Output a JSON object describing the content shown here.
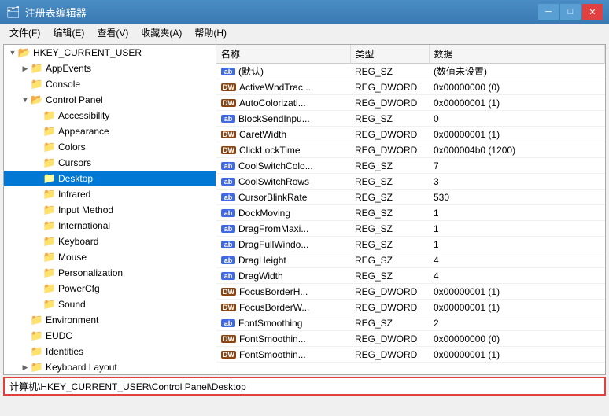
{
  "titleBar": {
    "title": "注册表编辑器",
    "icon": "🗂",
    "controls": {
      "minimize": "─",
      "maximize": "□",
      "close": "✕"
    }
  },
  "menuBar": {
    "items": [
      {
        "id": "file",
        "label": "文件(F)"
      },
      {
        "id": "edit",
        "label": "编辑(E)"
      },
      {
        "id": "view",
        "label": "查看(V)"
      },
      {
        "id": "favorites",
        "label": "收藏夹(A)"
      },
      {
        "id": "help",
        "label": "帮助(H)"
      }
    ]
  },
  "tree": {
    "items": [
      {
        "id": "hkcu",
        "label": "HKEY_CURRENT_USER",
        "indent": 0,
        "expanded": true,
        "selected": false,
        "hasExpand": true,
        "expandChar": "▼"
      },
      {
        "id": "appevents",
        "label": "AppEvents",
        "indent": 1,
        "expanded": false,
        "selected": false,
        "hasExpand": true,
        "expandChar": "▶"
      },
      {
        "id": "console",
        "label": "Console",
        "indent": 1,
        "expanded": false,
        "selected": false,
        "hasExpand": false,
        "expandChar": ""
      },
      {
        "id": "controlpanel",
        "label": "Control Panel",
        "indent": 1,
        "expanded": true,
        "selected": false,
        "hasExpand": true,
        "expandChar": "▼"
      },
      {
        "id": "accessibility",
        "label": "Accessibility",
        "indent": 2,
        "expanded": false,
        "selected": false,
        "hasExpand": false,
        "expandChar": ""
      },
      {
        "id": "appearance",
        "label": "Appearance",
        "indent": 2,
        "expanded": false,
        "selected": false,
        "hasExpand": false,
        "expandChar": ""
      },
      {
        "id": "colors",
        "label": "Colors",
        "indent": 2,
        "expanded": false,
        "selected": false,
        "hasExpand": false,
        "expandChar": ""
      },
      {
        "id": "cursors",
        "label": "Cursors",
        "indent": 2,
        "expanded": false,
        "selected": false,
        "hasExpand": false,
        "expandChar": ""
      },
      {
        "id": "desktop",
        "label": "Desktop",
        "indent": 2,
        "expanded": false,
        "selected": true,
        "hasExpand": false,
        "expandChar": ""
      },
      {
        "id": "infrared",
        "label": "Infrared",
        "indent": 2,
        "expanded": false,
        "selected": false,
        "hasExpand": false,
        "expandChar": ""
      },
      {
        "id": "inputmethod",
        "label": "Input Method",
        "indent": 2,
        "expanded": false,
        "selected": false,
        "hasExpand": false,
        "expandChar": ""
      },
      {
        "id": "international",
        "label": "International",
        "indent": 2,
        "expanded": false,
        "selected": false,
        "hasExpand": false,
        "expandChar": ""
      },
      {
        "id": "keyboard",
        "label": "Keyboard",
        "indent": 2,
        "expanded": false,
        "selected": false,
        "hasExpand": false,
        "expandChar": ""
      },
      {
        "id": "mouse",
        "label": "Mouse",
        "indent": 2,
        "expanded": false,
        "selected": false,
        "hasExpand": false,
        "expandChar": ""
      },
      {
        "id": "personalization",
        "label": "Personalization",
        "indent": 2,
        "expanded": false,
        "selected": false,
        "hasExpand": false,
        "expandChar": ""
      },
      {
        "id": "powercfg",
        "label": "PowerCfg",
        "indent": 2,
        "expanded": false,
        "selected": false,
        "hasExpand": false,
        "expandChar": ""
      },
      {
        "id": "sound",
        "label": "Sound",
        "indent": 2,
        "expanded": false,
        "selected": false,
        "hasExpand": false,
        "expandChar": ""
      },
      {
        "id": "environment",
        "label": "Environment",
        "indent": 1,
        "expanded": false,
        "selected": false,
        "hasExpand": false,
        "expandChar": ""
      },
      {
        "id": "eudc",
        "label": "EUDC",
        "indent": 1,
        "expanded": false,
        "selected": false,
        "hasExpand": false,
        "expandChar": ""
      },
      {
        "id": "identities",
        "label": "Identities",
        "indent": 1,
        "expanded": false,
        "selected": false,
        "hasExpand": false,
        "expandChar": ""
      },
      {
        "id": "keyboardlayout",
        "label": "Keyboard Layout",
        "indent": 1,
        "expanded": false,
        "selected": false,
        "hasExpand": true,
        "expandChar": "▶"
      }
    ]
  },
  "tableHeaders": {
    "name": "名称",
    "type": "类型",
    "data": "数据"
  },
  "tableRows": [
    {
      "iconType": "ab",
      "name": "(默认)",
      "type": "REG_SZ",
      "data": "(数值未设置)"
    },
    {
      "iconType": "dw",
      "name": "ActiveWndTrac...",
      "type": "REG_DWORD",
      "data": "0x00000000 (0)"
    },
    {
      "iconType": "dw",
      "name": "AutoColorizati...",
      "type": "REG_DWORD",
      "data": "0x00000001 (1)"
    },
    {
      "iconType": "ab",
      "name": "BlockSendInpu...",
      "type": "REG_SZ",
      "data": "0"
    },
    {
      "iconType": "dw",
      "name": "CaretWidth",
      "type": "REG_DWORD",
      "data": "0x00000001 (1)"
    },
    {
      "iconType": "dw",
      "name": "ClickLockTime",
      "type": "REG_DWORD",
      "data": "0x000004b0 (1200)"
    },
    {
      "iconType": "ab",
      "name": "CoolSwitchColo...",
      "type": "REG_SZ",
      "data": "7"
    },
    {
      "iconType": "ab",
      "name": "CoolSwitchRows",
      "type": "REG_SZ",
      "data": "3"
    },
    {
      "iconType": "ab",
      "name": "CursorBlinkRate",
      "type": "REG_SZ",
      "data": "530"
    },
    {
      "iconType": "ab",
      "name": "DockMoving",
      "type": "REG_SZ",
      "data": "1"
    },
    {
      "iconType": "ab",
      "name": "DragFromMaxi...",
      "type": "REG_SZ",
      "data": "1"
    },
    {
      "iconType": "ab",
      "name": "DragFullWindo...",
      "type": "REG_SZ",
      "data": "1"
    },
    {
      "iconType": "ab",
      "name": "DragHeight",
      "type": "REG_SZ",
      "data": "4"
    },
    {
      "iconType": "ab",
      "name": "DragWidth",
      "type": "REG_SZ",
      "data": "4"
    },
    {
      "iconType": "dw",
      "name": "FocusBorderH...",
      "type": "REG_DWORD",
      "data": "0x00000001 (1)"
    },
    {
      "iconType": "dw",
      "name": "FocusBorderW...",
      "type": "REG_DWORD",
      "data": "0x00000001 (1)"
    },
    {
      "iconType": "ab",
      "name": "FontSmoothing",
      "type": "REG_SZ",
      "data": "2"
    },
    {
      "iconType": "dw",
      "name": "FontSmoothin...",
      "type": "REG_DWORD",
      "data": "0x00000000 (0)"
    },
    {
      "iconType": "dw",
      "name": "FontSmoothin...",
      "type": "REG_DWORD",
      "data": "0x00000001 (1)"
    }
  ],
  "statusBar": {
    "path": "计算机\\HKEY_CURRENT_USER\\Control Panel\\Desktop"
  }
}
